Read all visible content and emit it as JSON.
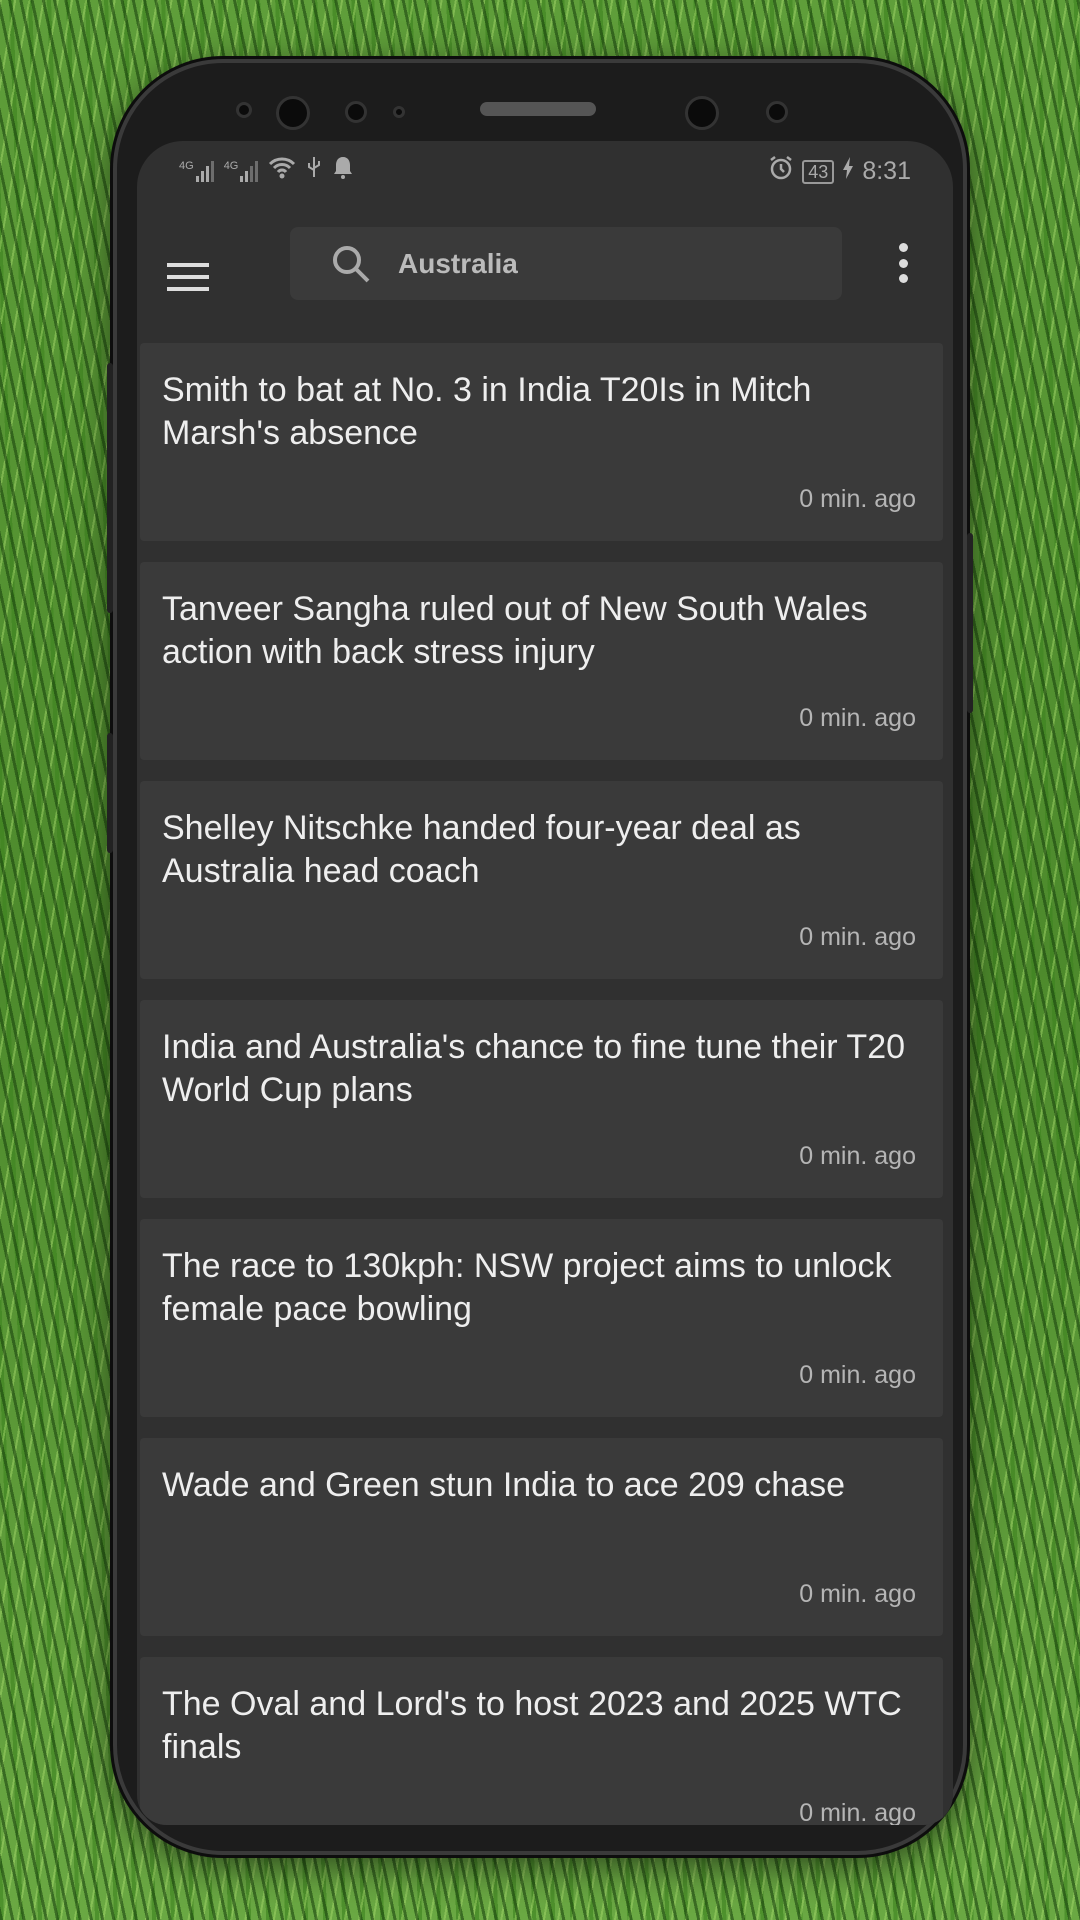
{
  "status": {
    "left_icons": [
      "4g-signal-icon",
      "4g-signal-icon",
      "wifi-icon",
      "usb-icon",
      "bell-icon"
    ],
    "network_label": "4G",
    "battery": "43",
    "time": "8:31"
  },
  "toolbar": {
    "search_value": "Australia",
    "search_icon": "search-icon"
  },
  "articles": [
    {
      "title": "Smith to bat at No. 3 in India T20Is in Mitch Marsh's absence",
      "time": "0 min. ago"
    },
    {
      "title": "Tanveer Sangha ruled out of New South Wales action with back stress injury",
      "time": "0 min. ago"
    },
    {
      "title": "Shelley Nitschke handed four-year deal as Australia head coach",
      "time": "0 min. ago"
    },
    {
      "title": "India and Australia's chance to fine tune their T20 World Cup plans",
      "time": "0 min. ago"
    },
    {
      "title": "The race to 130kph: NSW project aims to unlock female pace bowling",
      "time": "0 min. ago"
    },
    {
      "title": "Wade and Green stun India to ace 209 chase",
      "time": "0 min. ago"
    },
    {
      "title": "The Oval and Lord's to host 2023 and 2025 WTC finals",
      "time": "0 min. ago"
    }
  ]
}
